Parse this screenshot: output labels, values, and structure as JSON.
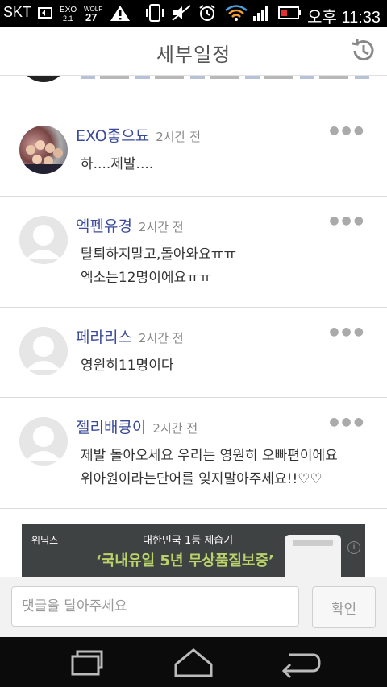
{
  "status_bar": {
    "carrier": "SKT",
    "time": "오후 11:33"
  },
  "header": {
    "title": "세부일정",
    "history_icon": "history-clock-icon"
  },
  "comments": [
    {
      "author": "EXO좋으됴",
      "time": "2시간 전",
      "lines": [
        "하....제발...."
      ]
    },
    {
      "author": "엑펜유경",
      "time": "2시간 전",
      "lines": [
        "탈퇴하지말고,돌아와요ㅠㅠ",
        "엑소는12명이에요ㅠㅠ"
      ]
    },
    {
      "author": "페라리스",
      "time": "2시간 전",
      "lines": [
        "영원히11명이다"
      ]
    },
    {
      "author": "젤리배큥이",
      "time": "2시간 전",
      "lines": [
        "제발 돌아오세요 우리는 영원히  오빠편이에요",
        "위아원이라는단어를 잊지말아주세요!!♡♡"
      ]
    }
  ],
  "ad": {
    "brand": "위닉스",
    "line1": "대한민국 1등 제습기",
    "line2": "‘국내유일 5년 무상품질보증’"
  },
  "comment_input": {
    "placeholder": "댓글을 달아주세요",
    "submit_label": "확인"
  },
  "nav_bar": {
    "recent_icon": "recent-apps-icon",
    "home_icon": "home-icon",
    "back_icon": "back-icon"
  }
}
